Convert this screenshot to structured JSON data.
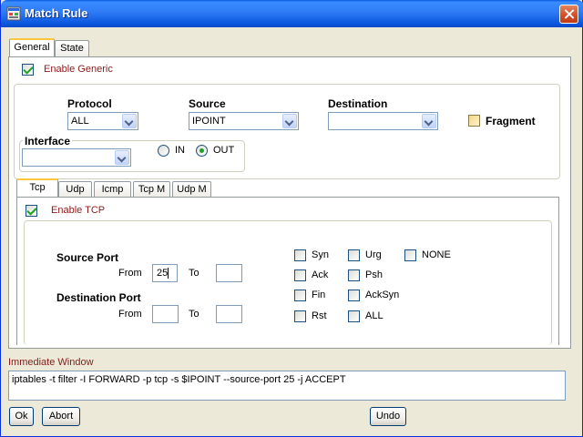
{
  "window": {
    "title": "Match Rule"
  },
  "tabs_outer": [
    {
      "label": "General",
      "active": true
    },
    {
      "label": "State",
      "active": false
    }
  ],
  "general": {
    "enable_generic": {
      "label": "Enable Generic",
      "checked": true
    },
    "protocol": {
      "label": "Protocol",
      "value": "ALL"
    },
    "source": {
      "label": "Source",
      "value": "IPOINT"
    },
    "destination": {
      "label": "Destination",
      "value": ""
    },
    "fragment": {
      "label": "Fragment",
      "checked": false
    },
    "interface": {
      "label": "Interface",
      "value": ""
    },
    "direction": {
      "in_label": "IN",
      "out_label": "OUT",
      "selected": "OUT"
    }
  },
  "tabs_inner": [
    {
      "label": "Tcp",
      "active": true
    },
    {
      "label": "Udp",
      "active": false
    },
    {
      "label": "Icmp",
      "active": false
    },
    {
      "label": "Tcp M",
      "active": false
    },
    {
      "label": "Udp M",
      "active": false
    }
  ],
  "tcp": {
    "enable_tcp": {
      "label": "Enable TCP",
      "checked": true
    },
    "source_port": {
      "label": "Source Port",
      "from_label": "From",
      "to_label": "To",
      "from": "25",
      "to": ""
    },
    "destination_port": {
      "label": "Destination Port",
      "from_label": "From",
      "to_label": "To",
      "from": "",
      "to": ""
    },
    "flags": {
      "syn": "Syn",
      "ack": "Ack",
      "fin": "Fin",
      "rst": "Rst",
      "urg": "Urg",
      "psh": "Psh",
      "acksyn": "AckSyn",
      "all": "ALL",
      "none": "NONE"
    }
  },
  "immediate": {
    "label": "Immediate Window",
    "text": "iptables -t filter -I FORWARD  -p tcp -s  $IPOINT --source-port 25 -j ACCEPT"
  },
  "buttons": {
    "ok": "Ok",
    "abort": "Abort",
    "undo": "Undo"
  },
  "colors": {
    "titlebar": "#0a5ae0",
    "label_red": "#8a1a1a",
    "check_green": "#21a121",
    "tab_highlight": "#ffc83c"
  }
}
